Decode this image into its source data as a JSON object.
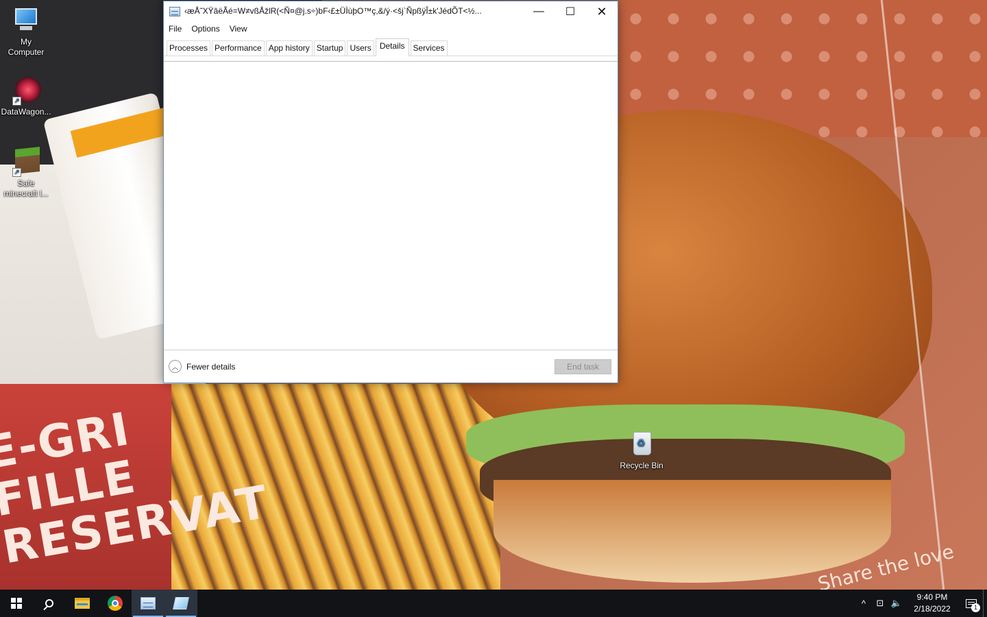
{
  "desktop": {
    "icons": [
      {
        "label_line1": "My",
        "label_line2": "Computer",
        "icon": "computer-icon"
      },
      {
        "label_line1": "DataWagon...",
        "label_line2": "",
        "icon": "datawagon-icon"
      },
      {
        "label_line1": "Safe",
        "label_line2": "minecraft l...",
        "icon": "minecraft-icon"
      },
      {
        "label_line1": "Recycle Bin",
        "label_line2": "",
        "icon": "recycle-bin-icon"
      }
    ],
    "wallpaper_text": {
      "big": "E-GRI FILLE RESERVAT",
      "share": "Share the love"
    }
  },
  "window": {
    "title": "‹æÅ˜XŸâëÃé=W≠vßÅžlR(<Ñ¤@j.s÷)bF‹£±ÜÌùþO™ç,&/ý·<šj`ÑpßÿÎ±k'JédÕT<½...",
    "controls": {
      "minimize": "—",
      "maximize": "☐",
      "close": "✕"
    },
    "menu": [
      "File",
      "Options",
      "View"
    ],
    "tabs": [
      "Processes",
      "Performance",
      "App history",
      "Startup",
      "Users",
      "Details",
      "Services"
    ],
    "active_tab": "Details",
    "footer": {
      "fewer_details": "Fewer details",
      "end_task": "End task"
    }
  },
  "taskbar": {
    "apps": [
      "start-icon",
      "search-icon",
      "file-explorer-icon",
      "chrome-icon",
      "task-manager-icon",
      "app-icon"
    ],
    "tray": {
      "chevron": "^",
      "network": "⊡",
      "volume": "🔈",
      "time": "9:40 PM",
      "date": "2/18/2022",
      "notification_count": "1"
    }
  },
  "colors": {
    "taskbar_bg": "#111317",
    "window_border": "#6e8db5",
    "end_task_disabled": "#cccccc",
    "active_tab_indicator": "#7fb6f0"
  }
}
